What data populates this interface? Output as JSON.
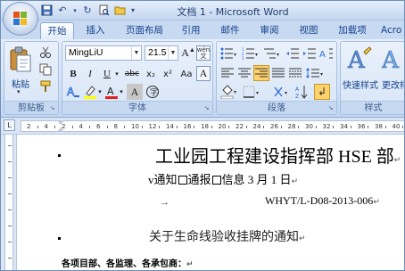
{
  "window": {
    "title": "文档 1 - Microsoft Word"
  },
  "tabs": [
    "开始",
    "插入",
    "页面布局",
    "引用",
    "邮件",
    "审阅",
    "视图",
    "加载项",
    "Acro"
  ],
  "ribbon": {
    "clipboard": {
      "label": "剪贴板",
      "paste_label": "粘贴"
    },
    "font": {
      "label": "字体",
      "font_name": "MingLiU",
      "font_size": "21.5",
      "wen_glyph": "wén",
      "bold": "B",
      "italic": "I",
      "underline": "U",
      "strike": "abc",
      "subscript": "x₂",
      "superscript": "x²",
      "aa": "Aa",
      "text_a": "A"
    },
    "paragraph": {
      "label": "段落"
    },
    "styles": {
      "label": "样式",
      "quick_styles": "快速样式",
      "change_styles": "更改样式"
    }
  },
  "ruler": {
    "numbers": [
      "2",
      "4",
      "2",
      "4",
      "6",
      "8",
      "10",
      "12",
      "14",
      "16",
      "18",
      "20",
      "22",
      "24",
      "26",
      "28",
      "30",
      "32",
      "34",
      "36",
      "38",
      "40"
    ]
  },
  "document": {
    "heading": "工业园工程建设指挥部 HSE 部",
    "notice_line_prefix": "v通知",
    "notice_tongbao": "通报",
    "notice_xinxi": "信息",
    "notice_date": " 3 月 1 日",
    "doc_number": "WHYT/L-D08-2013-006",
    "tab_arrow": "→",
    "subject": "关于生命线验收挂牌的通知",
    "recipients": "各项目部、各监理、各承包商：",
    "para_mark": "↵"
  },
  "colors": {
    "accent": "#15428b",
    "ribbon_bg": "#d5e3f6",
    "tab_active_bg": "#ffffff"
  }
}
